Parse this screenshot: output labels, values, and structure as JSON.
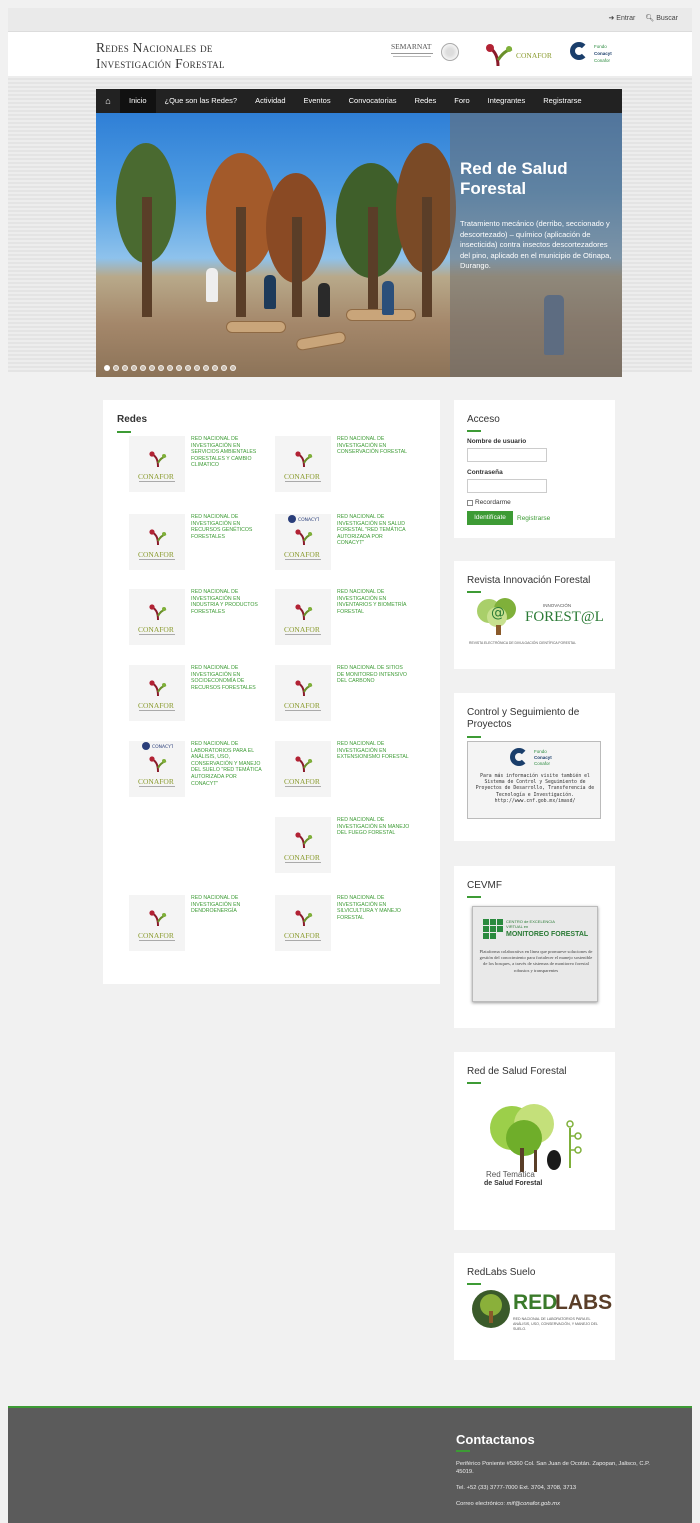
{
  "topbar": {
    "entrar": "Entrar",
    "buscar": "Buscar"
  },
  "header": {
    "title_line1": "Redes Nacionales de",
    "title_line2": "Investigación Forestal",
    "semarnat": "SEMARNAT",
    "conafor": "CONAFOR",
    "fondo_lines": [
      "Fondo",
      "Conacyt",
      "Conafor"
    ]
  },
  "nav": {
    "items": [
      "Inicio",
      "¿Que son las Redes?",
      "Actividad",
      "Eventos",
      "Convocatorias",
      "Redes",
      "Foro",
      "Integrantes",
      "Registrarse"
    ]
  },
  "hero": {
    "title": "Red de Salud Forestal",
    "description": "Tratamiento mecánico (derribo, seccionado y descortezado) – químico (aplicación de insecticida) contra insectos descortezadores del pino, aplicado en el municipio de Otinapa, Durango.",
    "slide_count": 15,
    "active_slide": 1
  },
  "redes": {
    "heading": "Redes",
    "thumb_label": "CONAFOR",
    "conacyt_label": "CONACYT",
    "items": [
      {
        "label": "Red Nacional de Investigación en Servicios Ambientales Forestales y Cambio Climatico",
        "conacyt": false
      },
      {
        "label": "Red Nacional de Investigación en Conservación Forestal",
        "conacyt": false
      },
      {
        "label": "Red Nacional de Investigación en Recursos Genéticos Forestales",
        "conacyt": false
      },
      {
        "label": "Red Nacional de Investigación en Salud Forestal \"Red Temática Autorizada por Conacyt\"",
        "conacyt": true
      },
      {
        "label": "Red Nacional de Investigación en Industria y Productos Forestales",
        "conacyt": false
      },
      {
        "label": "Red Nacional de Investigación en Inventarios y Biometría Forestal",
        "conacyt": false
      },
      {
        "label": "Red Nacional de Investigación en Socioeconomía de Recursos Forestales",
        "conacyt": false
      },
      {
        "label": "Red Nacional de Sitios de Monitoreo Intensivo del Carbono",
        "conacyt": false
      },
      {
        "label": "Red Nacional de Laboratorios para el Análisis, Uso, Conservación y Manejo del Suelo \"Red Temática Autorizada por Conacyt\"",
        "conacyt": true
      },
      {
        "label": "Red Nacional de Investigación en Extensionismo Forestal",
        "conacyt": false
      },
      {
        "label": "Red Nacional de Investigación en Manejo del Fuego Forestal",
        "conacyt": false
      },
      {
        "label": "Red Nacional de Investigación en Dendroenergía",
        "conacyt": false
      },
      {
        "label": "Red Nacional de Investigación en Silvicultura y Manejo Forestal",
        "conacyt": false
      }
    ]
  },
  "acceso": {
    "heading": "Acceso",
    "user_label": "Nombre de usuario",
    "pass_label": "Contraseña",
    "remember": "Recordarme",
    "login_button": "Identifícate",
    "register_link": "Registrarse"
  },
  "revista": {
    "heading": "Revista Innovación Forestal",
    "logo_small": "INNOVACIÓN",
    "logo_big": "FOREST@L",
    "caption": "REVISTA ELECTRÓNICA DE DIVULGACIÓN CIENTÍFICA FORESTAL"
  },
  "control": {
    "heading": "Control y Seguimiento de Proyectos",
    "fondo_lines": [
      "Fondo",
      "Conacyt",
      "Conafor"
    ],
    "text": "Para más información visite también el Sistema de Control y Seguimiento de Proyectos de Desarrollo, Transferencia de Tecnología e Investigación. http://www.cnf.gob.mx/imasd/"
  },
  "cevmf": {
    "heading": "CEVMF",
    "logo_small": "CENTRO de EXCELENCIA VIRTUAL en",
    "logo_big": "MONITOREO FORESTAL",
    "text": "Plataforma colaborativa en línea que promueve soluciones de gestión del conocimiento para fortalecer el manejo sostenible de los bosques, a través de sistemas de monitoreo forestal robustos y transparentes"
  },
  "salud": {
    "heading": "Red de Salud Forestal",
    "logo_line1": "Red Temática",
    "logo_line2": "de Salud Forestal"
  },
  "redlabs": {
    "heading": "RedLabs Suelo",
    "logo_red": "RED",
    "logo_labs": "LABS",
    "caption": "RED NACIONAL DE LABORATORIOS PARA EL ANÁLISIS, USO, CONSERVACIÓN, Y MANEJO DEL SUELO."
  },
  "footer": {
    "heading": "Contactanos",
    "address": "Periférico Poniente #5360 Col. San Juan de Ocotán. Zapopan, Jalisco, C.P. 45019.",
    "phone": "Tel. +52 (33) 3777-7000 Ext. 3704, 3708, 3713",
    "email_label": "Correo electrónico:",
    "email": "mif@conafor.gob.mx"
  },
  "colors": {
    "accent": "#3d9b35",
    "nav": "#222222",
    "footer": "#5b5b5b"
  }
}
